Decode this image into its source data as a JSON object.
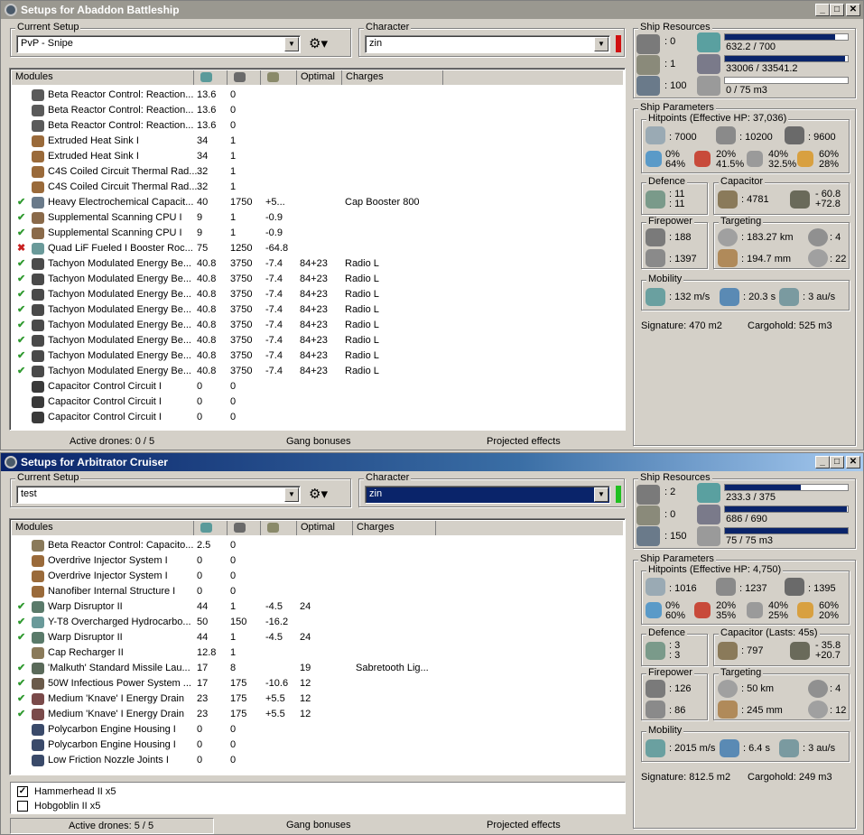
{
  "windows": [
    {
      "title": "Setups for Abaddon Battleship",
      "current_setup_label": "Current Setup",
      "setup_value": "PvP - Snipe",
      "character_label": "Character",
      "character_value": "zin",
      "character_status_color": "#d01010",
      "columns": [
        "Modules",
        "",
        "",
        "",
        "Optimal",
        "Charges"
      ],
      "modules": [
        {
          "s": "",
          "icon": "cog-icon",
          "c": "#5a5a5a",
          "name": "Beta Reactor Control: Reaction...",
          "cpu": "13.6",
          "pg": "0",
          "cap": "",
          "opt": "",
          "ch": ""
        },
        {
          "s": "",
          "icon": "cog-icon",
          "c": "#5a5a5a",
          "name": "Beta Reactor Control: Reaction...",
          "cpu": "13.6",
          "pg": "0",
          "cap": "",
          "opt": "",
          "ch": ""
        },
        {
          "s": "",
          "icon": "cog-icon",
          "c": "#5a5a5a",
          "name": "Beta Reactor Control: Reaction...",
          "cpu": "13.6",
          "pg": "0",
          "cap": "",
          "opt": "",
          "ch": ""
        },
        {
          "s": "",
          "icon": "heatsink-icon",
          "c": "#9a6a3a",
          "name": "Extruded Heat Sink I",
          "cpu": "34",
          "pg": "1",
          "cap": "",
          "opt": "",
          "ch": ""
        },
        {
          "s": "",
          "icon": "heatsink-icon",
          "c": "#9a6a3a",
          "name": "Extruded Heat Sink I",
          "cpu": "34",
          "pg": "1",
          "cap": "",
          "opt": "",
          "ch": ""
        },
        {
          "s": "",
          "icon": "heatsink-icon",
          "c": "#9a6a3a",
          "name": "C4S Coiled Circuit Thermal Rad...",
          "cpu": "32",
          "pg": "1",
          "cap": "",
          "opt": "",
          "ch": ""
        },
        {
          "s": "",
          "icon": "heatsink-icon",
          "c": "#9a6a3a",
          "name": "C4S Coiled Circuit Thermal Rad...",
          "cpu": "32",
          "pg": "1",
          "cap": "",
          "opt": "",
          "ch": ""
        },
        {
          "s": "ok",
          "icon": "cap-booster-icon",
          "c": "#6a7a8a",
          "name": "Heavy Electrochemical Capacit...",
          "cpu": "40",
          "pg": "1750",
          "cap": "+5...",
          "opt": "",
          "ch": "Cap Booster 800"
        },
        {
          "s": "ok",
          "icon": "cpu-icon",
          "c": "#8a6a4a",
          "name": "Supplemental Scanning CPU I",
          "cpu": "9",
          "pg": "1",
          "cap": "-0.9",
          "opt": "",
          "ch": ""
        },
        {
          "s": "ok",
          "icon": "cpu-icon",
          "c": "#8a6a4a",
          "name": "Supplemental Scanning CPU I",
          "cpu": "9",
          "pg": "1",
          "cap": "-0.9",
          "opt": "",
          "ch": ""
        },
        {
          "s": "bad",
          "icon": "booster-icon",
          "c": "#6a9a9a",
          "name": "Quad LiF Fueled I Booster Roc...",
          "cpu": "75",
          "pg": "1250",
          "cap": "-64.8",
          "opt": "",
          "ch": ""
        },
        {
          "s": "ok",
          "icon": "turret-icon",
          "c": "#4a4a4a",
          "name": "Tachyon Modulated Energy Be...",
          "cpu": "40.8",
          "pg": "3750",
          "cap": "-7.4",
          "opt": "84+23",
          "ch": "Radio L"
        },
        {
          "s": "ok",
          "icon": "turret-icon",
          "c": "#4a4a4a",
          "name": "Tachyon Modulated Energy Be...",
          "cpu": "40.8",
          "pg": "3750",
          "cap": "-7.4",
          "opt": "84+23",
          "ch": "Radio L"
        },
        {
          "s": "ok",
          "icon": "turret-icon",
          "c": "#4a4a4a",
          "name": "Tachyon Modulated Energy Be...",
          "cpu": "40.8",
          "pg": "3750",
          "cap": "-7.4",
          "opt": "84+23",
          "ch": "Radio L"
        },
        {
          "s": "ok",
          "icon": "turret-icon",
          "c": "#4a4a4a",
          "name": "Tachyon Modulated Energy Be...",
          "cpu": "40.8",
          "pg": "3750",
          "cap": "-7.4",
          "opt": "84+23",
          "ch": "Radio L"
        },
        {
          "s": "ok",
          "icon": "turret-icon",
          "c": "#4a4a4a",
          "name": "Tachyon Modulated Energy Be...",
          "cpu": "40.8",
          "pg": "3750",
          "cap": "-7.4",
          "opt": "84+23",
          "ch": "Radio L"
        },
        {
          "s": "ok",
          "icon": "turret-icon",
          "c": "#4a4a4a",
          "name": "Tachyon Modulated Energy Be...",
          "cpu": "40.8",
          "pg": "3750",
          "cap": "-7.4",
          "opt": "84+23",
          "ch": "Radio L"
        },
        {
          "s": "ok",
          "icon": "turret-icon",
          "c": "#4a4a4a",
          "name": "Tachyon Modulated Energy Be...",
          "cpu": "40.8",
          "pg": "3750",
          "cap": "-7.4",
          "opt": "84+23",
          "ch": "Radio L"
        },
        {
          "s": "ok",
          "icon": "turret-icon",
          "c": "#4a4a4a",
          "name": "Tachyon Modulated Energy Be...",
          "cpu": "40.8",
          "pg": "3750",
          "cap": "-7.4",
          "opt": "84+23",
          "ch": "Radio L"
        },
        {
          "s": "",
          "icon": "rig-icon",
          "c": "#3a3a3a",
          "name": "Capacitor Control Circuit I",
          "cpu": "0",
          "pg": "0",
          "cap": "",
          "opt": "",
          "ch": ""
        },
        {
          "s": "",
          "icon": "rig-icon",
          "c": "#3a3a3a",
          "name": "Capacitor Control Circuit I",
          "cpu": "0",
          "pg": "0",
          "cap": "",
          "opt": "",
          "ch": ""
        },
        {
          "s": "",
          "icon": "rig-icon",
          "c": "#3a3a3a",
          "name": "Capacitor Control Circuit I",
          "cpu": "0",
          "pg": "0",
          "cap": "",
          "opt": "",
          "ch": ""
        }
      ],
      "footer": {
        "drones": "Active drones: 0 / 5",
        "gang": "Gang bonuses",
        "projected": "Projected effects"
      },
      "resources": {
        "label": "Ship Resources",
        "turret": ": 0",
        "launcher": ": 1",
        "drone_bay": ": 100",
        "cpu": "632.2 / 700",
        "cpu_frac": 0.9,
        "pg": "33006 / 33541.2",
        "pg_frac": 0.98,
        "bay": "0 / 75 m3",
        "bay_frac": 0
      },
      "params": {
        "label": "Ship Parameters",
        "hp_label": "Hitpoints (Effective HP: 37,036)",
        "shield_hp": ": 7000",
        "armor_hp": ": 10200",
        "hull_hp": ": 9600",
        "res": [
          [
            "0%",
            "64%"
          ],
          [
            "20%",
            "41.5%"
          ],
          [
            "40%",
            "32.5%"
          ],
          [
            "60%",
            "28%"
          ]
        ],
        "defence_label": "Defence",
        "def1": ": 11",
        "def2": ": 11",
        "cap_label": "Capacitor",
        "cap": ": 4781",
        "cap1": "- 60.8",
        "cap2": "+72.8",
        "fire_label": "Firepower",
        "fire1": ": 188",
        "fire2": ": 1397",
        "tgt_label": "Targeting",
        "range": ": 183.27 km",
        "targets": ": 4",
        "scan": ": 194.7 mm",
        "sensor": ": 22",
        "mob_label": "Mobility",
        "speed": ": 132 m/s",
        "align": ": 20.3 s",
        "warp": ": 3 au/s",
        "signature": "Signature: 470 m2",
        "cargo": "Cargohold: 525 m3"
      }
    },
    {
      "title": "Setups for Arbitrator Cruiser",
      "current_setup_label": "Current Setup",
      "setup_value": "test",
      "character_label": "Character",
      "character_value": "zin",
      "character_status_color": "#20c020",
      "columns": [
        "Modules",
        "",
        "",
        "",
        "Optimal",
        "Charges"
      ],
      "modules": [
        {
          "s": "",
          "icon": "cap-recharger-icon",
          "c": "#8a7a5a",
          "name": "Beta Reactor Control: Capacito...",
          "cpu": "2.5",
          "pg": "0",
          "cap": "",
          "opt": "",
          "ch": ""
        },
        {
          "s": "",
          "icon": "injector-icon",
          "c": "#9a6a3a",
          "name": "Overdrive Injector System I",
          "cpu": "0",
          "pg": "0",
          "cap": "",
          "opt": "",
          "ch": ""
        },
        {
          "s": "",
          "icon": "injector-icon",
          "c": "#9a6a3a",
          "name": "Overdrive Injector System I",
          "cpu": "0",
          "pg": "0",
          "cap": "",
          "opt": "",
          "ch": ""
        },
        {
          "s": "",
          "icon": "nanofiber-icon",
          "c": "#9a6a3a",
          "name": "Nanofiber Internal Structure I",
          "cpu": "0",
          "pg": "0",
          "cap": "",
          "opt": "",
          "ch": ""
        },
        {
          "s": "ok",
          "icon": "disruptor-icon",
          "c": "#5a7a6a",
          "name": "Warp Disruptor II",
          "cpu": "44",
          "pg": "1",
          "cap": "-4.5",
          "opt": "24",
          "ch": ""
        },
        {
          "s": "ok",
          "icon": "afterburner-icon",
          "c": "#6a9a9a",
          "name": "Y-T8 Overcharged Hydrocarbo...",
          "cpu": "50",
          "pg": "150",
          "cap": "-16.2",
          "opt": "",
          "ch": ""
        },
        {
          "s": "ok",
          "icon": "disruptor-icon",
          "c": "#5a7a6a",
          "name": "Warp Disruptor II",
          "cpu": "44",
          "pg": "1",
          "cap": "-4.5",
          "opt": "24",
          "ch": ""
        },
        {
          "s": "",
          "icon": "cap-recharger-icon",
          "c": "#8a7a5a",
          "name": "Cap Recharger II",
          "cpu": "12.8",
          "pg": "1",
          "cap": "",
          "opt": "",
          "ch": ""
        },
        {
          "s": "ok",
          "icon": "launcher-icon",
          "c": "#5a6a5a",
          "name": "'Malkuth' Standard Missile Lau...",
          "cpu": "17",
          "pg": "8",
          "cap": "",
          "opt": "19",
          "ch": "Sabretooth Lig..."
        },
        {
          "s": "ok",
          "icon": "neut-icon",
          "c": "#6a5a4a",
          "name": "50W Infectious Power System ...",
          "cpu": "17",
          "pg": "175",
          "cap": "-10.6",
          "opt": "12",
          "ch": ""
        },
        {
          "s": "ok",
          "icon": "drain-icon",
          "c": "#7a4a4a",
          "name": "Medium 'Knave' I Energy Drain",
          "cpu": "23",
          "pg": "175",
          "cap": "+5.5",
          "opt": "12",
          "ch": ""
        },
        {
          "s": "ok",
          "icon": "drain-icon",
          "c": "#7a4a4a",
          "name": "Medium 'Knave' I Energy Drain",
          "cpu": "23",
          "pg": "175",
          "cap": "+5.5",
          "opt": "12",
          "ch": ""
        },
        {
          "s": "",
          "icon": "engine-rig-icon",
          "c": "#3a4a6a",
          "name": "Polycarbon Engine Housing I",
          "cpu": "0",
          "pg": "0",
          "cap": "",
          "opt": "",
          "ch": ""
        },
        {
          "s": "",
          "icon": "engine-rig-icon",
          "c": "#3a4a6a",
          "name": "Polycarbon Engine Housing I",
          "cpu": "0",
          "pg": "0",
          "cap": "",
          "opt": "",
          "ch": ""
        },
        {
          "s": "",
          "icon": "engine-rig-icon",
          "c": "#3a4a6a",
          "name": "Low Friction Nozzle Joints I",
          "cpu": "0",
          "pg": "0",
          "cap": "",
          "opt": "",
          "ch": ""
        }
      ],
      "drones": [
        {
          "checked": "✓",
          "name": "Hammerhead II x5"
        },
        {
          "checked": "",
          "name": "Hobgoblin II x5"
        }
      ],
      "footer": {
        "drones": "Active drones: 5 / 5",
        "gang": "Gang bonuses",
        "projected": "Projected effects"
      },
      "resources": {
        "label": "Ship Resources",
        "turret": ": 2",
        "launcher": ": 0",
        "drone_bay": ": 150",
        "cpu": "233.3 / 375",
        "cpu_frac": 0.62,
        "pg": "686 / 690",
        "pg_frac": 0.99,
        "bay": "75 / 75 m3",
        "bay_frac": 1
      },
      "params": {
        "label": "Ship Parameters",
        "hp_label": "Hitpoints (Effective HP: 4,750)",
        "shield_hp": ": 1016",
        "armor_hp": ": 1237",
        "hull_hp": ": 1395",
        "res": [
          [
            "0%",
            "60%"
          ],
          [
            "20%",
            "35%"
          ],
          [
            "40%",
            "25%"
          ],
          [
            "60%",
            "20%"
          ]
        ],
        "defence_label": "Defence",
        "def1": ": 3",
        "def2": ": 3",
        "cap_label": "Capacitor (Lasts: 45s)",
        "cap": ": 797",
        "cap1": "- 35.8",
        "cap2": "+20.7",
        "fire_label": "Firepower",
        "fire1": ": 126",
        "fire2": ": 86",
        "tgt_label": "Targeting",
        "range": ": 50 km",
        "targets": ": 4",
        "scan": ": 245 mm",
        "sensor": ": 12",
        "mob_label": "Mobility",
        "speed": ": 2015 m/s",
        "align": ": 6.4 s",
        "warp": ": 3 au/s",
        "signature": "Signature: 812.5 m2",
        "cargo": "Cargohold: 249 m3"
      }
    }
  ],
  "wbuttons": {
    "min": "_",
    "max": "□",
    "close": "✕"
  }
}
